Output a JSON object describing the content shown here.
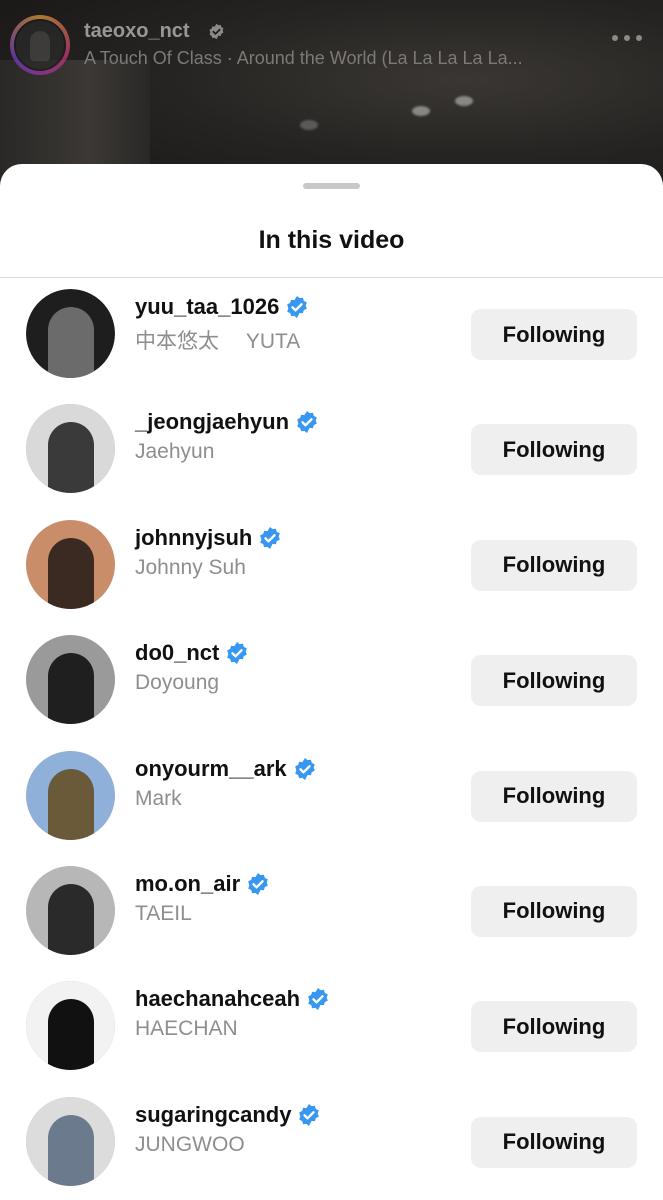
{
  "header": {
    "username": "taeoxo_nct",
    "subtitle": "A Touch Of Class · Around the World (La La La La La..."
  },
  "sheet": {
    "title": "In this video"
  },
  "users": [
    {
      "username": "yuu_taa_1026",
      "fullname": "中本悠太　 YUTA",
      "button": "Following",
      "avatar_colors": [
        "#1e1e1e",
        "#6b6b6b"
      ]
    },
    {
      "username": "_jeongjaehyun",
      "fullname": "Jaehyun",
      "button": "Following",
      "avatar_colors": [
        "#d9d9d9",
        "#3a3a3a"
      ]
    },
    {
      "username": "johnnyjsuh",
      "fullname": "Johnny Suh",
      "button": "Following",
      "avatar_colors": [
        "#c98d6a",
        "#3a2a22"
      ]
    },
    {
      "username": "do0_nct",
      "fullname": "Doyoung",
      "button": "Following",
      "avatar_colors": [
        "#9a9a9a",
        "#1f1f1f"
      ]
    },
    {
      "username": "onyourm__ark",
      "fullname": "Mark",
      "button": "Following",
      "avatar_colors": [
        "#8fb0d8",
        "#6a5a3a"
      ]
    },
    {
      "username": "mo.on_air",
      "fullname": "TAEIL",
      "button": "Following",
      "avatar_colors": [
        "#b7b7b7",
        "#2a2a2a"
      ]
    },
    {
      "username": "haechanahceah",
      "fullname": "HAECHAN",
      "button": "Following",
      "avatar_colors": [
        "#f2f2f2",
        "#111111"
      ]
    },
    {
      "username": "sugaringcandy",
      "fullname": "JUNGWOO",
      "button": "Following",
      "avatar_colors": [
        "#dcdcdc",
        "#6b7a8c"
      ]
    }
  ],
  "colors": {
    "verified": "#3897f0",
    "button_bg": "#efefef",
    "secondary_text": "#8e8e8e"
  }
}
